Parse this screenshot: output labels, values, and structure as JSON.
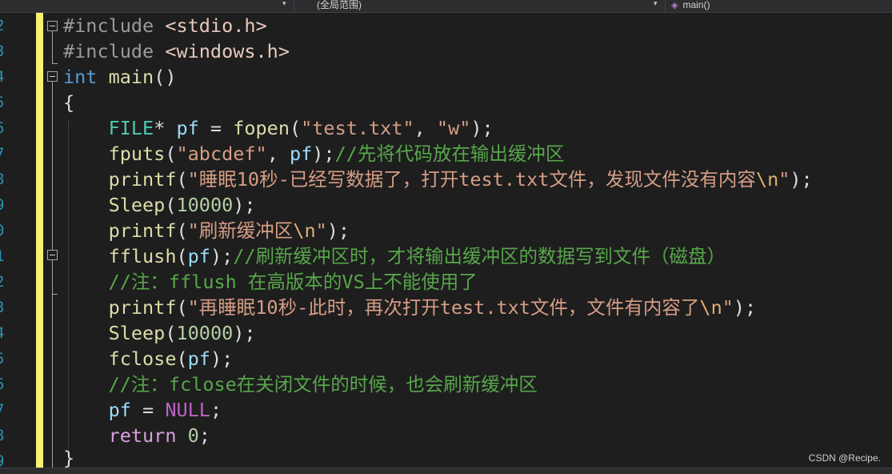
{
  "toolbar": {
    "scope_label": "(全局范围)",
    "member_label": "main()"
  },
  "gutter": {
    "line_numbers": [
      "2",
      "3",
      "4",
      "5",
      "6",
      "7",
      "8",
      "9",
      "0",
      "1",
      "2",
      "3",
      "4",
      "5",
      "6",
      "7",
      "8",
      "9"
    ]
  },
  "code": {
    "l1": {
      "pp": "#include",
      "sp": " ",
      "hdr": "<stdio.h>"
    },
    "l2": {
      "pp": "#include",
      "sp": " ",
      "hdr": "<windows.h>"
    },
    "l3": {
      "type": "int",
      "sp": " ",
      "fn": "main",
      "paren": "()"
    },
    "l4": {
      "brace": "{"
    },
    "l5": {
      "indent": "    ",
      "type": "FILE",
      "p1": "* ",
      "var": "pf",
      "p2": " = ",
      "fn": "fopen",
      "p3": "(",
      "s1": "\"test.txt\"",
      "p4": ", ",
      "s2": "\"w\"",
      "p5": ");"
    },
    "l6": {
      "indent": "    ",
      "fn": "fputs",
      "p1": "(",
      "s1": "\"abcdef\"",
      "p2": ", ",
      "var": "pf",
      "p3": ");",
      "comment": "//先将代码放在输出缓冲区"
    },
    "l7": {
      "indent": "    ",
      "fn": "printf",
      "p1": "(",
      "s1": "\"睡眠10秒-已经写数据了，打开test.txt文件，发现文件没有内容",
      "esc": "\\n",
      "s2": "\"",
      "p2": ");"
    },
    "l8": {
      "indent": "    ",
      "fn": "Sleep",
      "p1": "(",
      "num": "10000",
      "p2": ");"
    },
    "l9": {
      "indent": "    ",
      "fn": "printf",
      "p1": "(",
      "s1": "\"刷新缓冲区",
      "esc": "\\n",
      "s2": "\"",
      "p2": ");"
    },
    "l10": {
      "indent": "    ",
      "fn": "fflush",
      "p1": "(",
      "var": "pf",
      "p2": ");",
      "comment": "//刷新缓冲区时，才将输出缓冲区的数据写到文件（磁盘）"
    },
    "l11": {
      "indent": "    ",
      "comment": "//注：fflush 在高版本的VS上不能使用了"
    },
    "l12": {
      "indent": "    ",
      "fn": "printf",
      "p1": "(",
      "s1": "\"再睡眠10秒-此时，再次打开test.txt文件，文件有内容了",
      "esc": "\\n",
      "s2": "\"",
      "p2": ");"
    },
    "l13": {
      "indent": "    ",
      "fn": "Sleep",
      "p1": "(",
      "num": "10000",
      "p2": ");"
    },
    "l14": {
      "indent": "    ",
      "fn": "fclose",
      "p1": "(",
      "var": "pf",
      "p2": ");"
    },
    "l15": {
      "indent": "    ",
      "comment": "//注：fclose在关闭文件的时候，也会刷新缓冲区"
    },
    "l16": {
      "indent": "    ",
      "var": "pf",
      "p1": " = ",
      "macro": "NULL",
      "p2": ";"
    },
    "l17": {
      "indent": "    ",
      "kw": "return",
      "sp": " ",
      "num": "0",
      "p1": ";"
    },
    "l18": {
      "brace": "}"
    }
  },
  "watermark": "CSDN @Recipe."
}
